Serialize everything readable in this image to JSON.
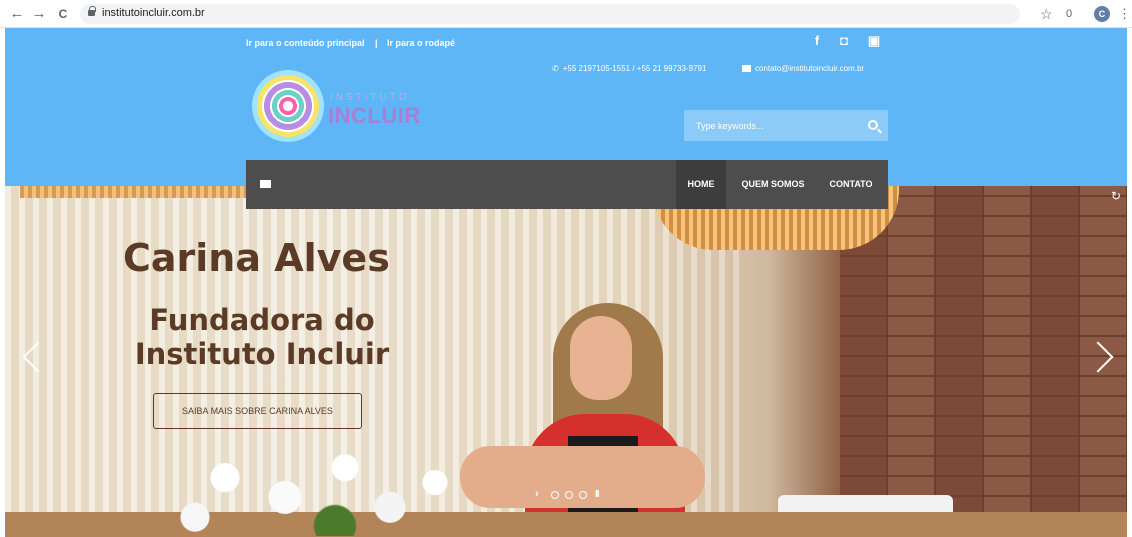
{
  "browser": {
    "url": "institutoincluir.com.br",
    "back_icon": "←",
    "forward_icon": "→",
    "reload_icon": "C",
    "star_icon": "☆",
    "extension_label": "0",
    "profile_initial": "C",
    "menu_icon": "⋮"
  },
  "header": {
    "skip_main": "Ir para o conteúdo principal",
    "skip_sep": "|",
    "skip_footer": "Ir para o rodapé",
    "social": {
      "facebook": "f",
      "instagram": "◘",
      "youtube": "▣"
    },
    "phone": "+55 2197105-1551 / +55 21 99733-9791",
    "email": "contato@institutoincluir.com.br",
    "logo_small": "INSTITUTO",
    "logo_big": "INCLUIR",
    "search_placeholder": "Type keywords..."
  },
  "nav": {
    "items": [
      {
        "label": "HOME",
        "active": true
      },
      {
        "label": "QUEM SOMOS",
        "active": false
      },
      {
        "label": "CONTATO",
        "active": false
      }
    ]
  },
  "hero": {
    "title": "Carina Alves",
    "subtitle": "Fundadora do Instituto Incluir",
    "button": "SAIBA MAIS SOBRE CARINA ALVES",
    "pager_next": "›",
    "pager_pause": "II",
    "slides": 3,
    "reload_icon": "↻"
  },
  "colors": {
    "header_bg": "#5eb6f6",
    "nav_bg": "#4d4d4d",
    "hero_text": "#5b3b26"
  }
}
